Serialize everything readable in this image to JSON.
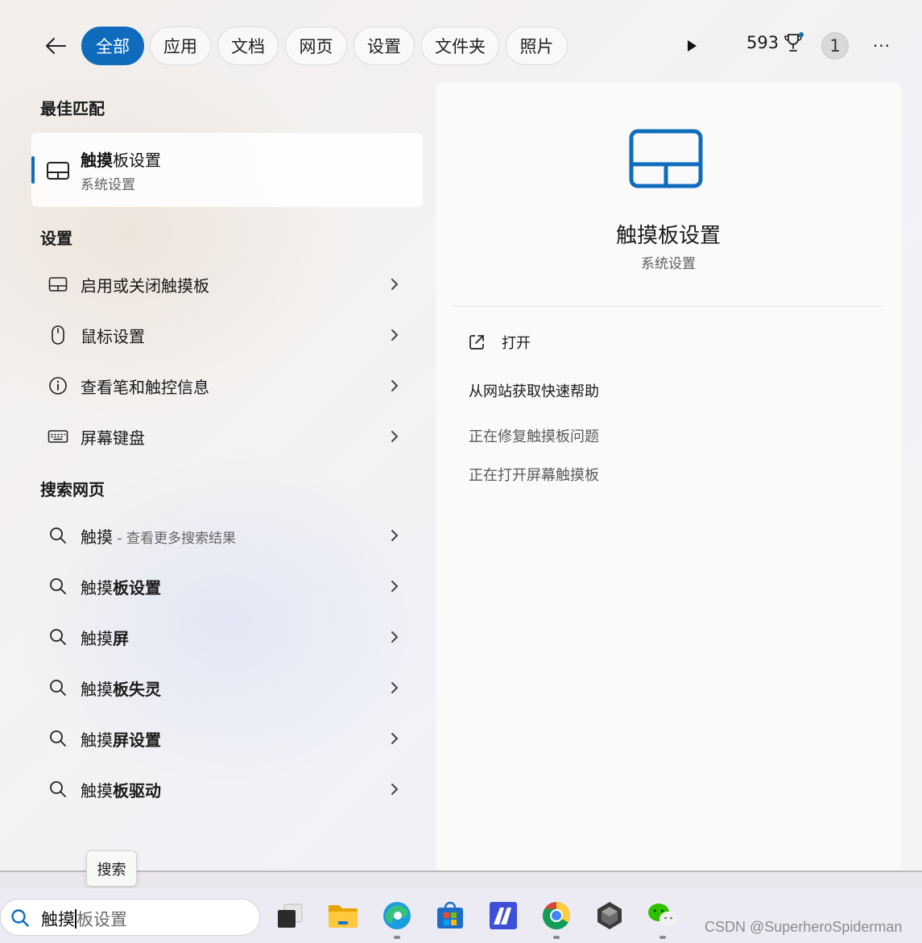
{
  "topbar": {
    "filters": [
      {
        "label": "全部",
        "active": true
      },
      {
        "label": "应用",
        "active": false
      },
      {
        "label": "文档",
        "active": false
      },
      {
        "label": "网页",
        "active": false
      },
      {
        "label": "设置",
        "active": false
      },
      {
        "label": "文件夹",
        "active": false
      },
      {
        "label": "照片",
        "active": false
      }
    ],
    "points": "593",
    "avatar_letter": "1",
    "more_label": "···"
  },
  "sections": {
    "best_match": "最佳匹配",
    "settings": "设置",
    "search_web": "搜索网页"
  },
  "best_match": {
    "title_bold": "触摸",
    "title_rest": "板设置",
    "subtitle": "系统设置",
    "icon": "touchpad-icon"
  },
  "settings_items": [
    {
      "label": "启用或关闭触摸板",
      "icon": "touchpad-icon"
    },
    {
      "label": "鼠标设置",
      "icon": "mouse-icon"
    },
    {
      "label": "查看笔和触控信息",
      "icon": "info-icon"
    },
    {
      "label": "屏幕键盘",
      "icon": "keyboard-icon"
    }
  ],
  "web_items": [
    {
      "normal": "触摸",
      "bold": "",
      "suffix": " - 查看更多搜索结果"
    },
    {
      "normal": "触摸",
      "bold": "板设置",
      "suffix": ""
    },
    {
      "normal": "触摸",
      "bold": "屏",
      "suffix": ""
    },
    {
      "normal": "触摸",
      "bold": "板失灵",
      "suffix": ""
    },
    {
      "normal": "触摸",
      "bold": "屏设置",
      "suffix": ""
    },
    {
      "normal": "触摸",
      "bold": "板驱动",
      "suffix": ""
    }
  ],
  "preview": {
    "title": "触摸板设置",
    "subtitle": "系统设置",
    "open_label": "打开",
    "help_title": "从网站获取快速帮助",
    "help_links": [
      "正在修复触摸板问题",
      "正在打开屏幕触摸板"
    ]
  },
  "tooltip": "搜索",
  "taskbar": {
    "search_typed": "触摸",
    "search_ghost": "板设置",
    "apps": [
      "task-view",
      "file-explorer",
      "edge",
      "microsoft-store",
      "app-ma",
      "chrome",
      "unity",
      "wechat"
    ],
    "watermark": "CSDN @SuperheroSpiderman"
  },
  "colors": {
    "accent": "#0f6cbd",
    "panel_bg": "#f3f2f2",
    "taskbar_bg": "#ecebf3"
  }
}
